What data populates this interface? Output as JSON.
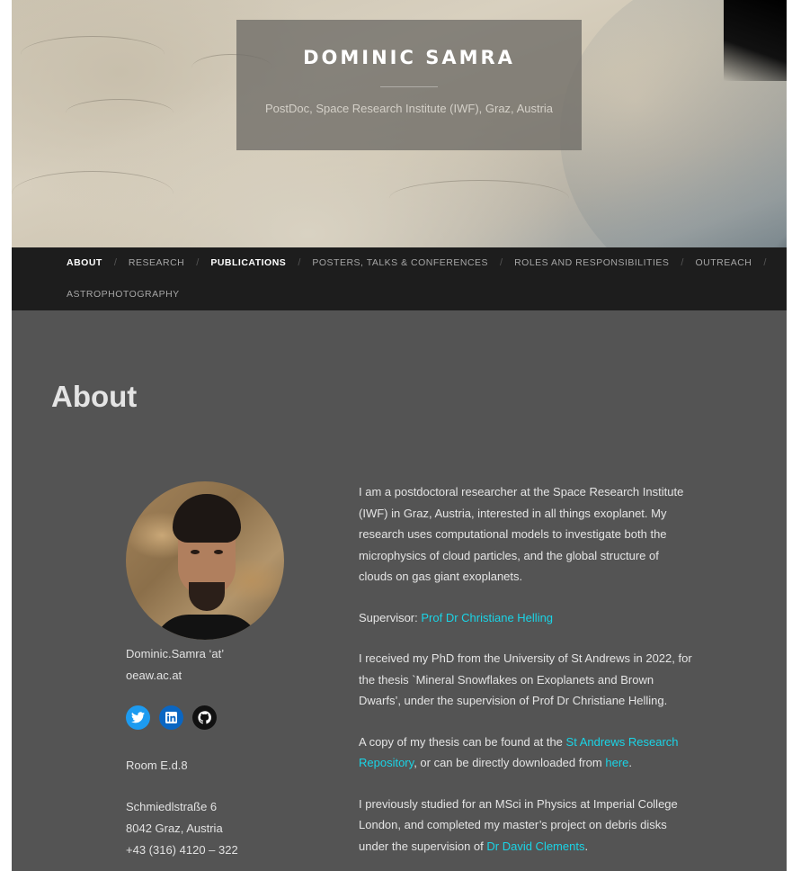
{
  "header": {
    "site_title": "DOMINIC SAMRA",
    "site_description": "PostDoc, Space Research Institute (IWF), Graz, Austria"
  },
  "nav": {
    "row1": [
      {
        "label": "ABOUT",
        "active": true
      },
      {
        "label": "RESEARCH",
        "active": false
      },
      {
        "label": "PUBLICATIONS",
        "active": true
      },
      {
        "label": "POSTERS, TALKS & CONFERENCES",
        "active": false
      },
      {
        "label": "ROLES AND RESPONSIBILITIES",
        "active": false
      },
      {
        "label": "OUTREACH",
        "active": false
      }
    ],
    "row2": [
      {
        "label": "ASTROPHOTOGRAPHY",
        "active": false
      }
    ],
    "separator": "/"
  },
  "page_title": "About",
  "sidebar": {
    "email": "Dominic.Samra ‘at’ oeaw.ac.at",
    "socials": [
      {
        "name": "twitter",
        "icon": "twitter-icon"
      },
      {
        "name": "linkedin",
        "icon": "linkedin-icon"
      },
      {
        "name": "github",
        "icon": "github-icon"
      }
    ],
    "room": "Room E.d.8",
    "address_lines": [
      "Schmiedlstraße 6",
      "8042 Graz, Austria",
      "+43 (316) 4120 – 322"
    ]
  },
  "main": {
    "p1": "I am a postdoctoral researcher at the Space Research Institute (IWF) in Graz, Austria, interested in all things exoplanet. My research uses computational models to investigate both the microphysics of cloud particles, and the global structure of clouds on gas giant exoplanets.",
    "supervisor_prefix": "Supervisor: ",
    "supervisor_link": "Prof Dr Christiane Helling",
    "p3": "I received my PhD from the University of St Andrews in 2022, for the thesis `Mineral Snowflakes on Exoplanets and Brown Dwarfs’, under the supervision of Prof Dr Christiane Helling.",
    "p4_prefix": "A copy of my thesis can be found at the ",
    "p4_link1": "St Andrews Research Repository",
    "p4_middle": ", or can be directly downloaded from ",
    "p4_link2": "here",
    "p4_suffix": ".",
    "p5_prefix": "I previously studied for an MSci in Physics at Imperial College London, and completed my master’s project on debris disks under the supervision of ",
    "p5_link": "Dr David Clements",
    "p5_suffix": "."
  },
  "colors": {
    "background": "#545454",
    "nav_background": "#1d1d1d",
    "link": "#1ad4e6",
    "twitter": "#1d9bf0",
    "linkedin": "#0a66c2"
  }
}
